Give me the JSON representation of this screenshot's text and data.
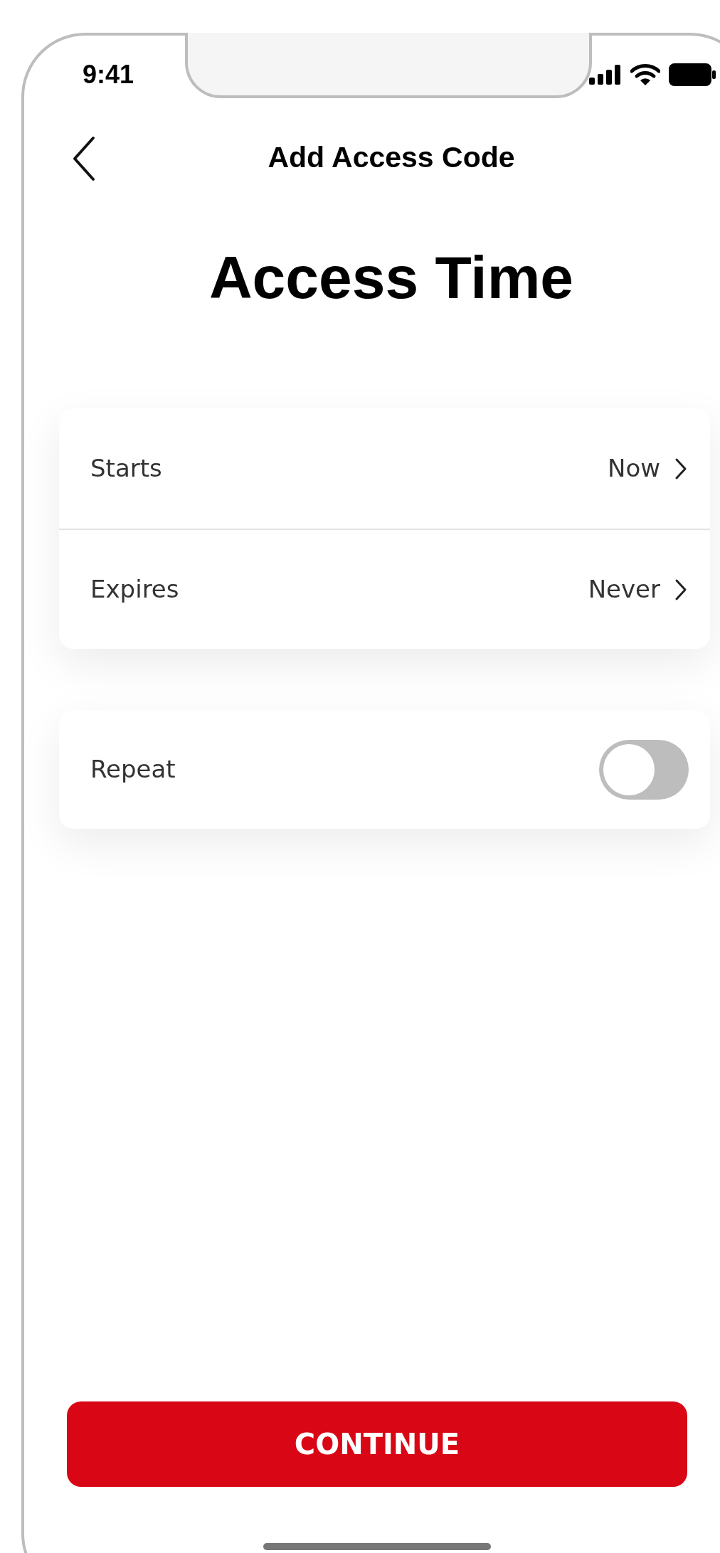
{
  "status_bar": {
    "time": "9:41"
  },
  "nav": {
    "title": "Add Access Code"
  },
  "heading": "Access Time",
  "schedule": [
    {
      "label": "Starts",
      "value": "Now"
    },
    {
      "label": "Expires",
      "value": "Never"
    }
  ],
  "repeat": {
    "label": "Repeat",
    "on": false
  },
  "button": "CONTINUE"
}
